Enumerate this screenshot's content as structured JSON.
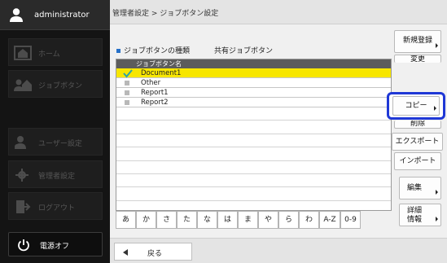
{
  "sidebar": {
    "user": "administrator",
    "items": [
      {
        "label": "ホーム",
        "icon": "home-icon"
      },
      {
        "label": "ジョブボタン",
        "icon": "job-button-icon"
      },
      {
        "label": "ユーザー設定",
        "icon": "user-settings-icon"
      },
      {
        "label": "管理者設定",
        "icon": "gear-icon"
      },
      {
        "label": "ログアウト",
        "icon": "logout-icon"
      }
    ],
    "power": "電源オフ"
  },
  "header": {
    "breadcrumb": "管理者設定 > ジョブボタン設定"
  },
  "job_type": {
    "label": "ジョブボタンの種類",
    "value": "共有ジョブボタン"
  },
  "list": {
    "header": "ジョブボタン名",
    "rows": [
      {
        "label": "Document1",
        "selected": true
      },
      {
        "label": "Other",
        "selected": false
      },
      {
        "label": "Report1",
        "selected": false
      },
      {
        "label": "Report2",
        "selected": false
      }
    ]
  },
  "kana": [
    "あ",
    "か",
    "さ",
    "た",
    "な",
    "は",
    "ま",
    "や",
    "ら",
    "わ",
    "A-Z",
    "0-9"
  ],
  "actions": {
    "new": "新規登録",
    "change": "変更",
    "copy": "コピー",
    "delete": "削除",
    "export": "エクスポート",
    "import": "インポート",
    "edit": "編集",
    "detail_1": "詳細",
    "detail_2": "情報"
  },
  "back": "戻る",
  "colors": {
    "accent": "#1f38d6",
    "selected_row": "#f7e600",
    "checkmark": "#2aa3a8"
  }
}
